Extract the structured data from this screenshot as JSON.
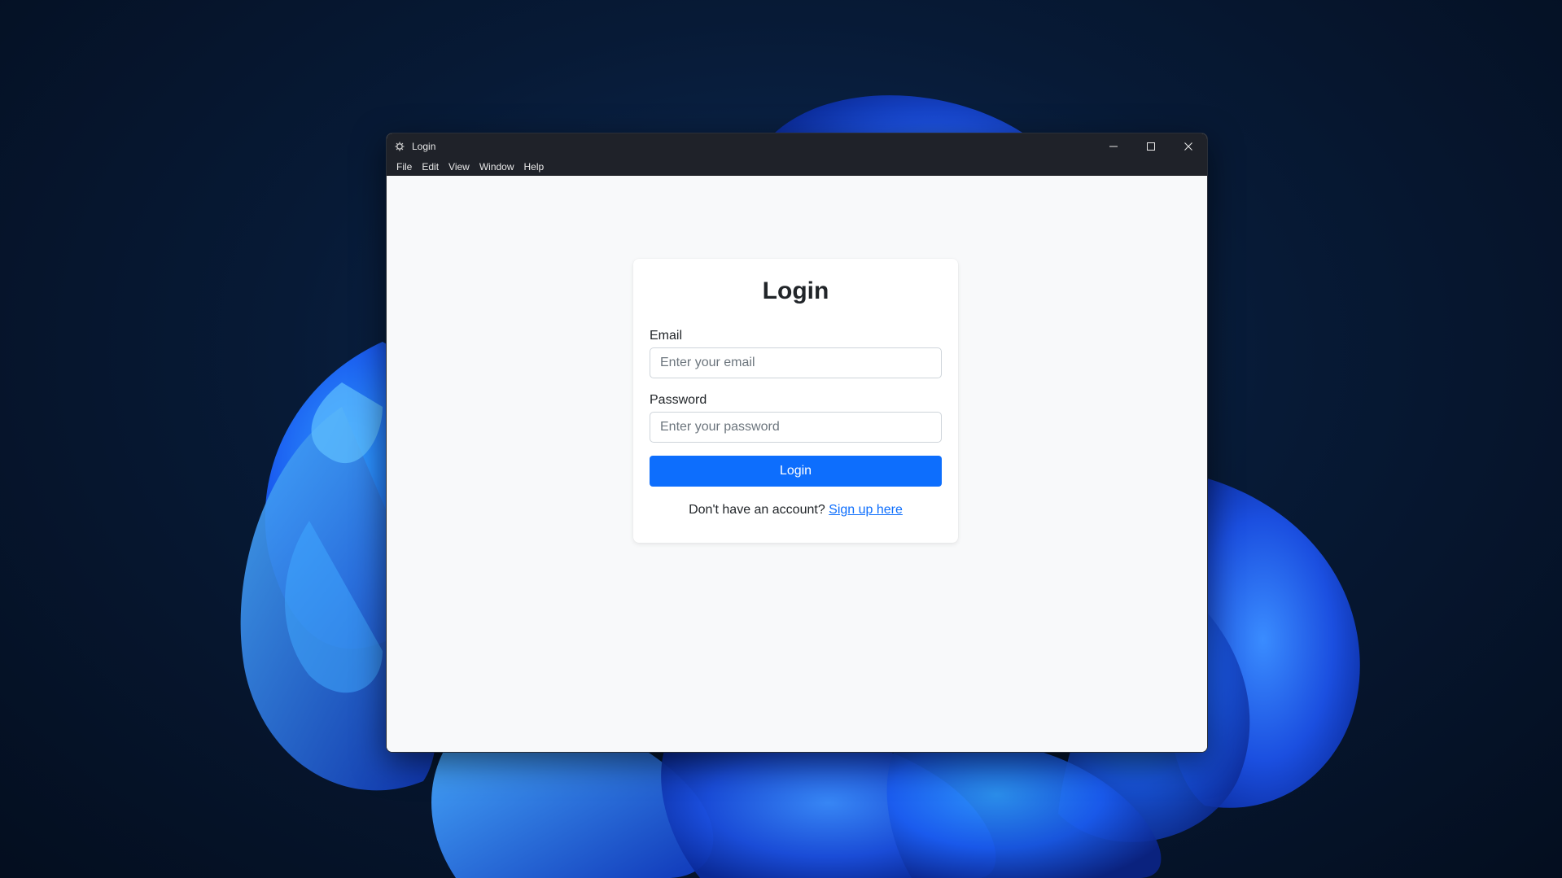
{
  "window": {
    "title": "Login",
    "app_icon": "gear-icon"
  },
  "menu": {
    "items": [
      "File",
      "Edit",
      "View",
      "Window",
      "Help"
    ]
  },
  "form": {
    "heading": "Login",
    "email_label": "Email",
    "email_placeholder": "Enter your email",
    "email_value": "",
    "password_label": "Password",
    "password_placeholder": "Enter your password",
    "password_value": "",
    "submit_label": "Login",
    "signup_prompt": "Don't have an account?",
    "signup_link": "Sign up here"
  },
  "colors": {
    "primary": "#0d6efd",
    "titlebar": "#1f2229",
    "page_background": "#f8f9fa",
    "card_background": "#ffffff"
  }
}
